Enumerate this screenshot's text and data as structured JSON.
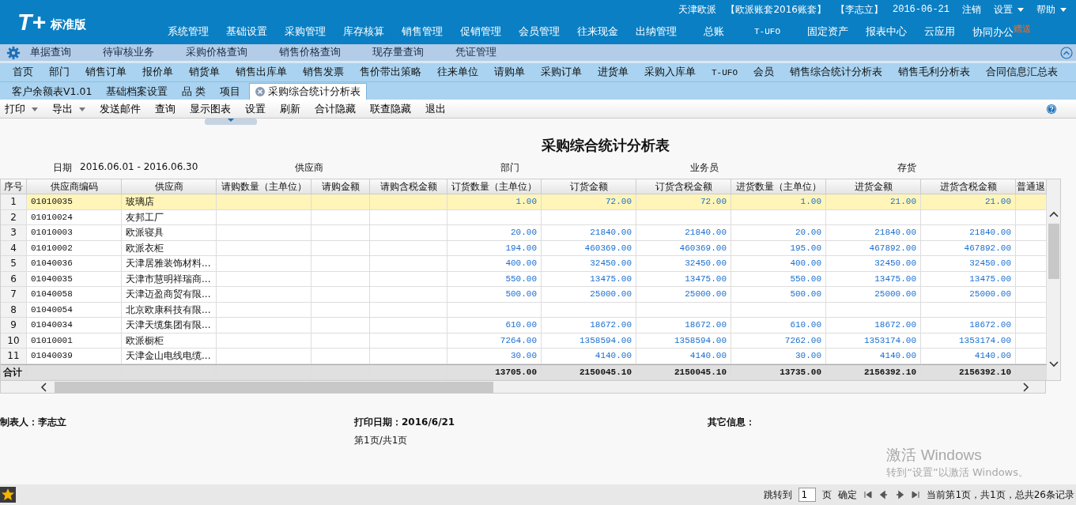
{
  "header": {
    "logo": "T+",
    "edition": "标准版",
    "info": [
      "天津欧派",
      "【欧派账套2016账套】",
      "【李志立】",
      "2016-06-21"
    ],
    "links": [
      {
        "label": "注销",
        "dropdown": false
      },
      {
        "label": "设置",
        "dropdown": true
      },
      {
        "label": "帮助",
        "dropdown": true
      }
    ],
    "menu": [
      {
        "label": "系统管理"
      },
      {
        "label": "基础设置"
      },
      {
        "label": "采购管理"
      },
      {
        "label": "库存核算"
      },
      {
        "label": "销售管理"
      },
      {
        "label": "促销管理"
      },
      {
        "label": "会员管理"
      },
      {
        "label": "往来现金"
      },
      {
        "label": "出纳管理"
      },
      {
        "label": "总账"
      },
      {
        "label": "T-UFO"
      },
      {
        "label": "固定资产"
      },
      {
        "label": "报表中心"
      },
      {
        "label": "云应用"
      },
      {
        "label": "协同办公",
        "badge": "赠送"
      }
    ]
  },
  "quick_bar": [
    "单据查询",
    "待审核业务",
    "采购价格查询",
    "销售价格查询",
    "现存量查询",
    "凭证管理"
  ],
  "shortcuts": [
    "首页",
    "部门",
    "销售订单",
    "报价单",
    "销货单",
    "销售出库单",
    "销售发票",
    "售价带出策略",
    "往来单位",
    "请购单",
    "采购订单",
    "进货单",
    "采购入库单",
    "T-UFO",
    "会员",
    "销售综合统计分析表",
    "销售毛利分析表",
    "合同信息汇总表"
  ],
  "tabs": [
    {
      "label": "客户余额表V1.01",
      "selected": false
    },
    {
      "label": "基础档案设置",
      "selected": false
    },
    {
      "label": "品 类",
      "selected": false
    },
    {
      "label": "项目",
      "selected": false
    },
    {
      "label": "采购综合统计分析表",
      "selected": true
    }
  ],
  "toolbar": [
    {
      "label": "打印",
      "dropdown": true
    },
    {
      "label": "导出",
      "dropdown": true
    },
    {
      "label": "发送邮件",
      "dropdown": false
    },
    {
      "label": "查询",
      "dropdown": false
    },
    {
      "label": "显示图表",
      "dropdown": false
    },
    {
      "label": "设置",
      "dropdown": false
    },
    {
      "label": "刷新",
      "dropdown": false
    },
    {
      "label": "合计隐藏",
      "dropdown": false
    },
    {
      "label": "联查隐藏",
      "dropdown": false
    },
    {
      "label": "退出",
      "dropdown": false
    }
  ],
  "report": {
    "title": "采购综合统计分析表",
    "filters": [
      {
        "label": "日期",
        "value": "2016.06.01 - 2016.06.30"
      },
      {
        "label": "供应商"
      },
      {
        "label": "部门"
      },
      {
        "label": "业务员"
      },
      {
        "label": "存货"
      }
    ],
    "columns": [
      "序号",
      "供应商编码",
      "供应商",
      "请购数量（主单位）",
      "请购金额",
      "请购含税金额",
      "订货数量（主单位）",
      "订货金额",
      "订货含税金额",
      "进货数量（主单位）",
      "进货金额",
      "进货含税金额",
      "普通退"
    ],
    "rows": [
      {
        "no": "1",
        "code": "01010035",
        "supplier": "玻璃店",
        "selected": true,
        "order_qty": "1.00",
        "order_amount": "72.00",
        "order_tax_amount": "72.00",
        "in_qty": "1.00",
        "in_amount": "21.00",
        "in_tax_amount": "21.00"
      },
      {
        "no": "2",
        "code": "01010024",
        "supplier": "友邦工厂",
        "selected": false
      },
      {
        "no": "3",
        "code": "01010003",
        "supplier": "欧派寝具",
        "selected": false,
        "order_qty": "20.00",
        "order_amount": "21840.00",
        "order_tax_amount": "21840.00",
        "in_qty": "20.00",
        "in_amount": "21840.00",
        "in_tax_amount": "21840.00"
      },
      {
        "no": "4",
        "code": "01010002",
        "supplier": "欧派衣柜",
        "selected": false,
        "order_qty": "194.00",
        "order_amount": "460369.00",
        "order_tax_amount": "460369.00",
        "in_qty": "195.00",
        "in_amount": "467892.00",
        "in_tax_amount": "467892.00"
      },
      {
        "no": "5",
        "code": "01040036",
        "supplier": "天津居雅装饰材料...",
        "selected": false,
        "order_qty": "400.00",
        "order_amount": "32450.00",
        "order_tax_amount": "32450.00",
        "in_qty": "400.00",
        "in_amount": "32450.00",
        "in_tax_amount": "32450.00"
      },
      {
        "no": "6",
        "code": "01040035",
        "supplier": "天津市慧明祥瑞商...",
        "selected": false,
        "order_qty": "550.00",
        "order_amount": "13475.00",
        "order_tax_amount": "13475.00",
        "in_qty": "550.00",
        "in_amount": "13475.00",
        "in_tax_amount": "13475.00"
      },
      {
        "no": "7",
        "code": "01040058",
        "supplier": "天津迈盈商贸有限...",
        "selected": false,
        "order_qty": "500.00",
        "order_amount": "25000.00",
        "order_tax_amount": "25000.00",
        "in_qty": "500.00",
        "in_amount": "25000.00",
        "in_tax_amount": "25000.00"
      },
      {
        "no": "8",
        "code": "01040054",
        "supplier": "北京欧康科技有限...",
        "selected": false
      },
      {
        "no": "9",
        "code": "01040034",
        "supplier": "天津天缆集团有限...",
        "selected": false,
        "order_qty": "610.00",
        "order_amount": "18672.00",
        "order_tax_amount": "18672.00",
        "in_qty": "610.00",
        "in_amount": "18672.00",
        "in_tax_amount": "18672.00"
      },
      {
        "no": "10",
        "code": "01010001",
        "supplier": "欧派橱柜",
        "selected": false,
        "order_qty": "7264.00",
        "order_amount": "1358594.00",
        "order_tax_amount": "1358594.00",
        "in_qty": "7262.00",
        "in_amount": "1353174.00",
        "in_tax_amount": "1353174.00"
      },
      {
        "no": "11",
        "code": "01040039",
        "supplier": "天津金山电线电缆...",
        "selected": false,
        "order_qty": "30.00",
        "order_amount": "4140.00",
        "order_tax_amount": "4140.00",
        "in_qty": "30.00",
        "in_amount": "4140.00",
        "in_tax_amount": "4140.00"
      }
    ],
    "total": {
      "label": "合计",
      "order_qty": "13705.00",
      "order_amount": "2150045.10",
      "order_tax_amount": "2150045.10",
      "in_qty": "13735.00",
      "in_amount": "2156392.10",
      "in_tax_amount": "2156392.10"
    },
    "footer": [
      {
        "label": "制表人：",
        "value": "李志立"
      },
      {
        "label": "打印日期：",
        "value": "2016/6/21"
      },
      {
        "label": "其它信息："
      }
    ],
    "page_info": "第1页/共1页"
  },
  "pager": {
    "jump_label": "跳转到",
    "page": "1",
    "unit": "页",
    "confirm": "确定",
    "status": "当前第1页，共1页，总共26条记录"
  },
  "os_notice": {
    "title": "激活 Windows",
    "text": "转到“设置”以激活 Windows。"
  }
}
